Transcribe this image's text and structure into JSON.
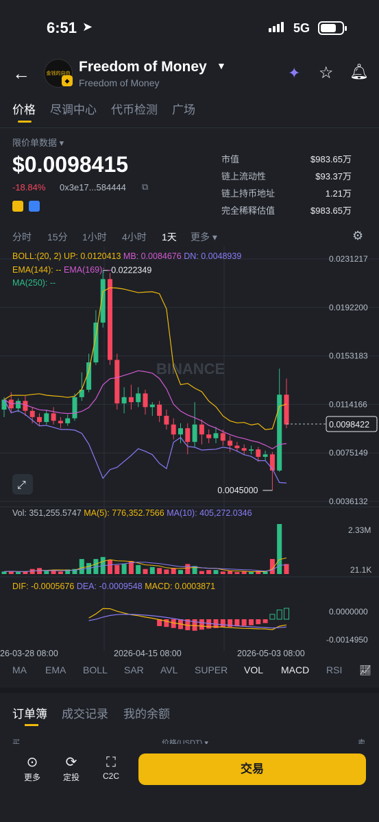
{
  "status_bar": {
    "time": "6:51",
    "network": "5G"
  },
  "header": {
    "title": "Freedom of Money",
    "subtitle": "Freedom of Money",
    "logo_text": "金钱的自由"
  },
  "tabs": [
    "价格",
    "尽调中心",
    "代币检测",
    "广场"
  ],
  "price_panel": {
    "source_label": "限价单数据",
    "price": "$0.0098415",
    "change": "-18.84%",
    "address": "0x3e17...584444",
    "stats": [
      {
        "label": "市值",
        "value": "$983.65万"
      },
      {
        "label": "链上流动性",
        "value": "$93.37万"
      },
      {
        "label": "链上持币地址",
        "value": "1.21万"
      },
      {
        "label": "完全稀释估值",
        "value": "$983.65万"
      }
    ]
  },
  "timeframes": [
    "分时",
    "15分",
    "1小时",
    "4小时",
    "1天",
    "更多"
  ],
  "chart_data": {
    "type": "candlestick",
    "indicators": {
      "boll": "BOLL:(20, 2)",
      "up": "UP: 0.0120413",
      "mb": "MB: 0.0084676",
      "dn": "DN: 0.0048939",
      "ema144": "EMA(144): --",
      "ema169": "EMA(169): --",
      "ma250": "MA(250): --"
    },
    "price_axis": [
      "0.0231217",
      "0.0192200",
      "0.0153183",
      "0.0114166",
      "0.0075149",
      "0.0036132"
    ],
    "ylim": [
      0.0036132,
      0.0231217
    ],
    "current_price": "0.0098422",
    "high_label": "0.0222349",
    "low_label": "0.0045000",
    "watermark": "BINANCE",
    "candles": [
      [
        0.011,
        0.0118,
        0.0104,
        0.012
      ],
      [
        0.0118,
        0.0111,
        0.0107,
        0.0124
      ],
      [
        0.0111,
        0.0117,
        0.0108,
        0.0119
      ],
      [
        0.0117,
        0.0109,
        0.0105,
        0.0121
      ],
      [
        0.0109,
        0.0104,
        0.0099,
        0.0112
      ],
      [
        0.0104,
        0.01,
        0.0097,
        0.0107
      ],
      [
        0.01,
        0.0107,
        0.0098,
        0.011
      ],
      [
        0.0107,
        0.0101,
        0.0098,
        0.0112
      ],
      [
        0.0101,
        0.0099,
        0.0095,
        0.0104
      ],
      [
        0.0099,
        0.0103,
        0.0097,
        0.0106
      ],
      [
        0.0103,
        0.012,
        0.0101,
        0.0123
      ],
      [
        0.012,
        0.0126,
        0.0117,
        0.014
      ],
      [
        0.0126,
        0.0148,
        0.0124,
        0.0155
      ],
      [
        0.0148,
        0.018,
        0.0146,
        0.019
      ],
      [
        0.018,
        0.0215,
        0.0176,
        0.0222
      ],
      [
        0.0215,
        0.015,
        0.0146,
        0.022
      ],
      [
        0.015,
        0.0115,
        0.011,
        0.0155
      ],
      [
        0.0115,
        0.012,
        0.0107,
        0.0128
      ],
      [
        0.012,
        0.0116,
        0.011,
        0.013
      ],
      [
        0.0116,
        0.0123,
        0.0112,
        0.0128
      ],
      [
        0.0123,
        0.0112,
        0.0106,
        0.0126
      ],
      [
        0.0112,
        0.0114,
        0.0105,
        0.0116
      ],
      [
        0.0114,
        0.0105,
        0.01,
        0.0117
      ],
      [
        0.0105,
        0.0098,
        0.0094,
        0.011
      ],
      [
        0.0098,
        0.009,
        0.0086,
        0.0103
      ],
      [
        0.009,
        0.0095,
        0.0083,
        0.0099
      ],
      [
        0.0095,
        0.0084,
        0.0074,
        0.0099
      ],
      [
        0.0084,
        0.0098,
        0.008,
        0.0116
      ],
      [
        0.0098,
        0.009,
        0.0082,
        0.0102
      ],
      [
        0.009,
        0.0087,
        0.0083,
        0.0094
      ],
      [
        0.0087,
        0.0091,
        0.0083,
        0.0096
      ],
      [
        0.0091,
        0.0085,
        0.0081,
        0.0094
      ],
      [
        0.0085,
        0.0081,
        0.0076,
        0.0089
      ],
      [
        0.0081,
        0.0079,
        0.0076,
        0.0084
      ],
      [
        0.0079,
        0.0077,
        0.0074,
        0.0082
      ],
      [
        0.0077,
        0.0078,
        0.0074,
        0.0081
      ],
      [
        0.0078,
        0.0072,
        0.0068,
        0.008
      ],
      [
        0.0072,
        0.0074,
        0.0069,
        0.0077
      ],
      [
        0.0074,
        0.0061,
        0.0045,
        0.0076
      ],
      [
        0.0061,
        0.0122,
        0.006,
        0.0143
      ],
      [
        0.0122,
        0.0098,
        0.0095,
        0.0135
      ]
    ],
    "volume": {
      "label": "Vol: 351,255.5747",
      "ma5": "MA(5): 776,352.7566",
      "ma10": "MA(10): 405,272.0346",
      "axis": [
        "2.33M",
        "21.1K"
      ],
      "values": [
        0.05,
        0.06,
        0.04,
        0.05,
        0.1,
        0.12,
        0.06,
        0.08,
        0.05,
        0.09,
        0.1,
        0.3,
        0.22,
        0.3,
        0.34,
        0.28,
        0.18,
        0.2,
        0.26,
        0.18,
        0.1,
        0.14,
        0.12,
        0.09,
        0.12,
        0.08,
        0.2,
        0.16,
        0.06,
        0.08,
        0.08,
        0.05,
        0.06,
        0.04,
        0.05,
        0.04,
        0.06,
        0.05,
        0.3,
        1.0,
        0.2
      ]
    },
    "macd": {
      "dif": "DIF: -0.0005676",
      "dea": "DEA: -0.0009548",
      "macd": "MACD: 0.0003871",
      "axis": [
        "0.0000000",
        "-0.0014950"
      ],
      "hist": [
        0,
        0,
        0,
        0,
        0,
        0,
        0,
        0,
        0,
        0,
        0,
        0,
        0,
        0,
        0,
        0,
        0,
        0,
        0,
        0,
        0,
        0,
        -0.25,
        -0.28,
        -0.32,
        -0.36,
        -0.4,
        -0.42,
        -0.38,
        -0.34,
        -0.32,
        -0.3,
        -0.28,
        -0.26,
        -0.24,
        -0.22,
        -0.18,
        -0.14,
        0.18,
        0.34,
        0.4
      ]
    },
    "dates": [
      "26-03-28 08:00",
      "2026-04-15 08:00",
      "2026-05-03 08:00"
    ]
  },
  "indicator_tabs": [
    "MA",
    "EMA",
    "BOLL",
    "SAR",
    "AVL",
    "SUPER",
    "VOL",
    "MACD",
    "RSI"
  ],
  "orderbook": {
    "tabs": [
      "订单簿",
      "成交记录",
      "我的余额"
    ],
    "buy_label": "买",
    "sell_label": "卖",
    "price_header": "价格(USDT)"
  },
  "bottom_nav": [
    {
      "label": "更多",
      "icon": "more-icon"
    },
    {
      "label": "定投",
      "icon": "recurring-icon"
    },
    {
      "label": "C2C",
      "icon": "c2c-icon"
    }
  ],
  "trade_button": "交易",
  "colors": {
    "up": "#2ebd85",
    "down": "#f6465d",
    "accent": "#f0b90b",
    "bg": "#1e2026"
  }
}
